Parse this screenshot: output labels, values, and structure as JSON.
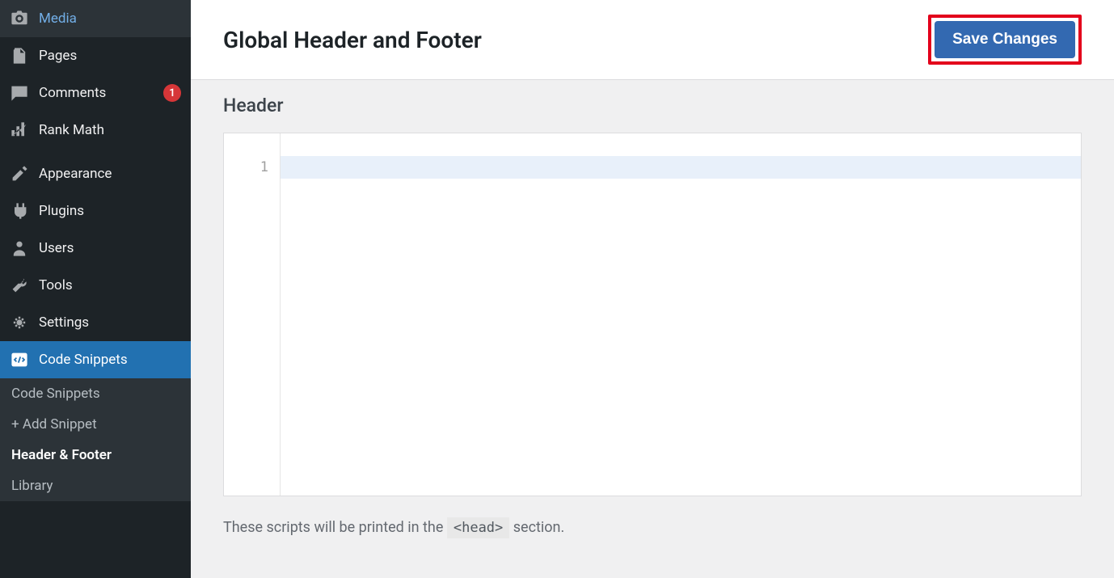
{
  "sidebar": {
    "items": [
      {
        "label": "Media",
        "icon": "media"
      },
      {
        "label": "Pages",
        "icon": "pages"
      },
      {
        "label": "Comments",
        "icon": "comments",
        "badge": "1"
      },
      {
        "label": "Rank Math",
        "icon": "rankmath"
      }
    ],
    "items2": [
      {
        "label": "Appearance",
        "icon": "appearance"
      },
      {
        "label": "Plugins",
        "icon": "plugins"
      },
      {
        "label": "Users",
        "icon": "users"
      },
      {
        "label": "Tools",
        "icon": "tools"
      },
      {
        "label": "Settings",
        "icon": "settings"
      },
      {
        "label": "Code Snippets",
        "icon": "code",
        "active": true
      }
    ],
    "submenu": [
      {
        "label": "Code Snippets"
      },
      {
        "label": "+ Add Snippet"
      },
      {
        "label": "Header & Footer",
        "current": true
      },
      {
        "label": "Library"
      }
    ]
  },
  "page": {
    "title": "Global Header and Footer",
    "save_label": "Save Changes",
    "section_title": "Header",
    "editor": {
      "line_number": "1"
    },
    "help_text_before": "These scripts will be printed in the ",
    "help_code": "<head>",
    "help_text_after": " section."
  }
}
